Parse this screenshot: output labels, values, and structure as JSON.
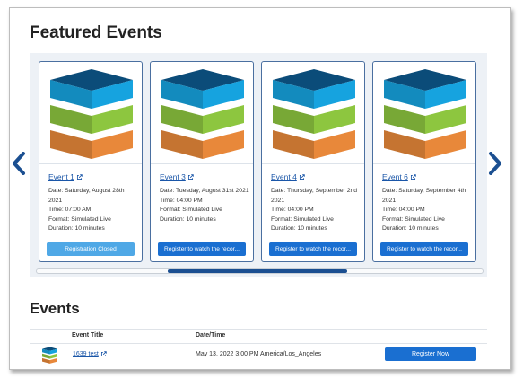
{
  "featured": {
    "heading": "Featured Events",
    "cards": [
      {
        "title": "Event 1",
        "date": "Date: Saturday, August 28th 2021",
        "time": "Time: 07:00 AM",
        "format": "Format: Simulated Live",
        "duration": "Duration: 10 minutes",
        "button": "Registration Closed",
        "button_state": "closed"
      },
      {
        "title": "Event 3",
        "date": "Date: Tuesday, August 31st 2021",
        "time": "Time: 04:00 PM",
        "format": "Format: Simulated Live",
        "duration": "Duration: 10 minutes",
        "button": "Register to watch the recor...",
        "button_state": "active"
      },
      {
        "title": "Event 4",
        "date": "Date: Thursday, September 2nd 2021",
        "time": "Time: 04:00 PM",
        "format": "Format: Simulated Live",
        "duration": "Duration: 10 minutes",
        "button": "Register to watch the recor...",
        "button_state": "active"
      },
      {
        "title": "Event 6",
        "date": "Date: Saturday, September 4th 2021",
        "time": "Time: 04:00 PM",
        "format": "Format: Simulated Live",
        "duration": "Duration: 10 minutes",
        "button": "Register to watch the recor...",
        "button_state": "active"
      }
    ]
  },
  "events": {
    "heading": "Events",
    "columns": [
      "Event Title",
      "Date/Time"
    ],
    "rows": [
      {
        "title": "1639 test",
        "datetime": "May 13, 2022 3:00 PM America/Los_Angeles",
        "button": "Register Now"
      }
    ]
  },
  "colors": {
    "accent": "#1a6fd1",
    "closed": "#4fa8e6",
    "nav_arrow": "#1b4f91",
    "cube_top": "#0b4c79",
    "cube_blue": "#16a3df",
    "cube_green": "#8dc63f",
    "cube_orange": "#e8883a"
  },
  "icons": {
    "prev": "chevron-left-icon",
    "next": "chevron-right-icon",
    "external": "external-link-icon",
    "event_image": "layered-cube-icon"
  }
}
